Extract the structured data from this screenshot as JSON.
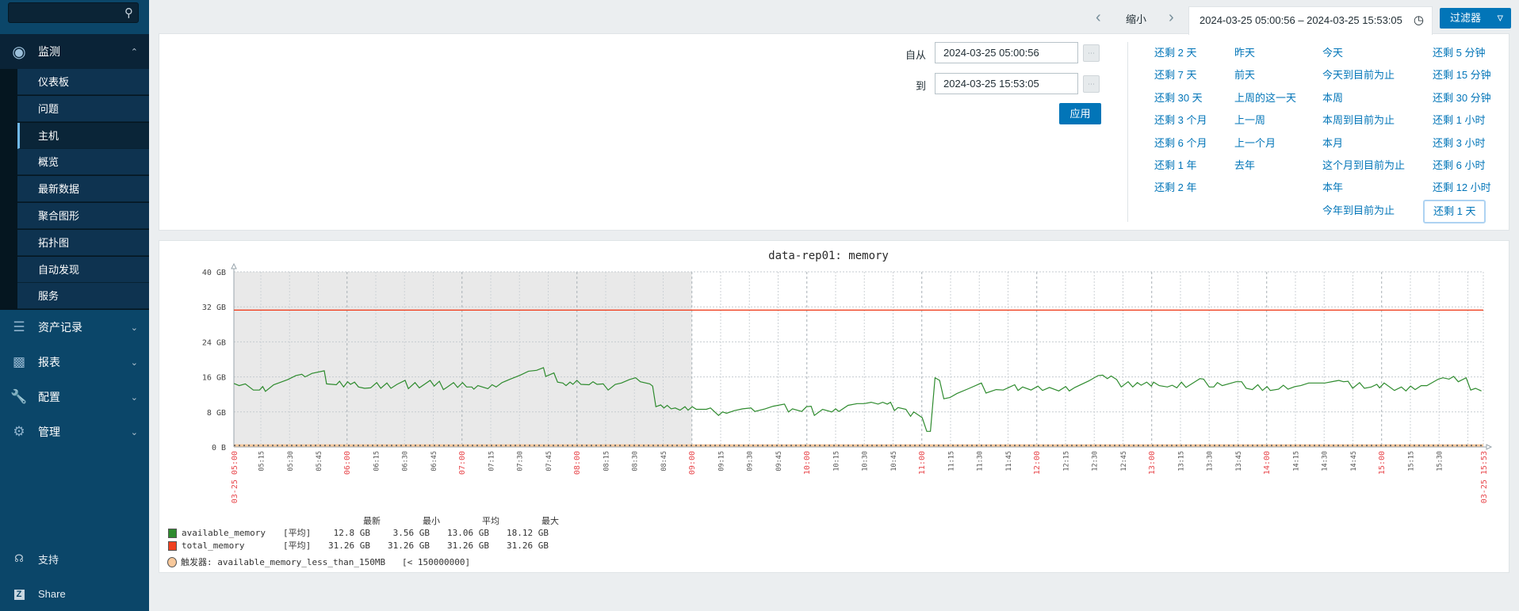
{
  "sidebar": {
    "search_placeholder": "",
    "monitor": {
      "label": "监测",
      "items": [
        "仪表板",
        "问题",
        "主机",
        "概览",
        "最新数据",
        "聚合图形",
        "拓扑图",
        "自动发现",
        "服务"
      ],
      "active": "主机"
    },
    "menus": [
      "资产记录",
      "报表",
      "配置",
      "管理"
    ],
    "footer": {
      "support": "支持",
      "share": "Share"
    }
  },
  "topbar": {
    "zoom_out": "缩小",
    "time_range": "2024-03-25 05:00:56 – 2024-03-25 15:53:05",
    "filter_button": "过滤器"
  },
  "filter": {
    "from_label": "自从",
    "from_value": "2024-03-25 05:00:56",
    "to_label": "到",
    "to_value": "2024-03-25 15:53:05",
    "apply": "应用",
    "quick": [
      [
        "还剩 2 天",
        "还剩 7 天",
        "还剩 30 天",
        "还剩 3 个月",
        "还剩 6 个月",
        "还剩 1 年",
        "还剩 2 年"
      ],
      [
        "昨天",
        "前天",
        "上周的这一天",
        "上一周",
        "上一个月",
        "去年"
      ],
      [
        "今天",
        "今天到目前为止",
        "本周",
        "本周到目前为止",
        "本月",
        "这个月到目前为止",
        "本年",
        "今年到目前为止"
      ],
      [
        "还剩 5 分钟",
        "还剩 15 分钟",
        "还剩 30 分钟",
        "还剩 1 小时",
        "还剩 3 小时",
        "还剩 6 小时",
        "还剩 12 小时",
        "还剩 1 天"
      ]
    ],
    "selected": "还剩 1 天"
  },
  "legend": {
    "headers": [
      "最新",
      "最小",
      "平均",
      "最大"
    ],
    "rows": [
      {
        "name": "available_memory",
        "func": "[平均]",
        "values": [
          "12.8 GB",
          "3.56 GB",
          "13.06 GB",
          "18.12 GB"
        ],
        "color": "#2e8b2e"
      },
      {
        "name": "total_memory",
        "func": "[平均]",
        "values": [
          "31.26 GB",
          "31.26 GB",
          "31.26 GB",
          "31.26 GB"
        ],
        "color": "#f0401f"
      }
    ],
    "trigger": {
      "label": "触发器: available_memory_less_than_150MB",
      "condition": "[< 150000000]",
      "color": "#f7c89b"
    }
  },
  "chart_data": {
    "type": "line",
    "title": "data-rep01: memory",
    "x_unit": "minutes since 03-25 05:00",
    "x_range": [
      0.93,
      653.08
    ],
    "x_start_label": "03-25 05:00",
    "x_end_label": "03-25 15:53",
    "shaded_until": 240,
    "ylim": [
      0,
      40
    ],
    "y_unit": "GB",
    "y_ticks": [
      {
        "v": 0,
        "label": "0 B"
      },
      {
        "v": 8,
        "label": "8 GB"
      },
      {
        "v": 16,
        "label": "16 GB"
      },
      {
        "v": 24,
        "label": "24 GB"
      },
      {
        "v": 32,
        "label": "32 GB"
      },
      {
        "v": 40,
        "label": "40 GB"
      }
    ],
    "x_ticks": [
      "05:15",
      "05:30",
      "05:45",
      "06:00",
      "06:15",
      "06:30",
      "06:45",
      "07:00",
      "07:15",
      "07:30",
      "07:45",
      "08:00",
      "08:15",
      "08:30",
      "08:45",
      "09:00",
      "09:15",
      "09:30",
      "09:45",
      "10:00",
      "10:15",
      "10:30",
      "10:45",
      "11:00",
      "11:15",
      "11:30",
      "11:45",
      "12:00",
      "12:15",
      "12:30",
      "12:45",
      "13:00",
      "13:15",
      "13:30",
      "13:45",
      "14:00",
      "14:15",
      "14:30",
      "14:45",
      "15:00",
      "15:15",
      "15:30"
    ],
    "grid": true,
    "series": [
      {
        "name": "available_memory",
        "color": "#2e8b2e",
        "points": [
          [
            1,
            14.5
          ],
          [
            3.7,
            14.0
          ],
          [
            6.9,
            14.4
          ],
          [
            11.1,
            13.0
          ],
          [
            14.3,
            13.0
          ],
          [
            16,
            13.8
          ],
          [
            17.4,
            12.7
          ],
          [
            21.7,
            14.2
          ],
          [
            24.8,
            14.7
          ],
          [
            29.1,
            15.4
          ],
          [
            33.3,
            16.3
          ],
          [
            36.4,
            16.6
          ],
          [
            38.1,
            16.0
          ],
          [
            41.7,
            16.8
          ],
          [
            48.1,
            17.4
          ],
          [
            49.3,
            14.4
          ],
          [
            54.4,
            14.2
          ],
          [
            56.1,
            15.0
          ],
          [
            58.2,
            13.7
          ],
          [
            60.3,
            14.9
          ],
          [
            61.8,
            14.3
          ],
          [
            63.9,
            14.8
          ],
          [
            66,
            13.7
          ],
          [
            69.2,
            13.4
          ],
          [
            72.3,
            13.5
          ],
          [
            75.5,
            14.7
          ],
          [
            77.6,
            13.4
          ],
          [
            80.8,
            14.6
          ],
          [
            82.9,
            13.4
          ],
          [
            86.1,
            14.3
          ],
          [
            90.3,
            15.2
          ],
          [
            92,
            13.3
          ],
          [
            95.5,
            14.7
          ],
          [
            97.7,
            13.5
          ],
          [
            103.4,
            15.2
          ],
          [
            105.5,
            13.9
          ],
          [
            108.2,
            15.0
          ],
          [
            110.3,
            13.1
          ],
          [
            112.4,
            13.7
          ],
          [
            115.6,
            14.7
          ],
          [
            117.7,
            13.6
          ],
          [
            120.3,
            14.7
          ],
          [
            122.4,
            13.7
          ],
          [
            125.1,
            13.7
          ],
          [
            126.2,
            13.2
          ],
          [
            128.3,
            14.0
          ],
          [
            133.5,
            13.3
          ],
          [
            135.7,
            14.2
          ],
          [
            137.8,
            13.7
          ],
          [
            140.9,
            14.7
          ],
          [
            145.2,
            15.5
          ],
          [
            150.4,
            16.4
          ],
          [
            154.7,
            17.3
          ],
          [
            158.9,
            17.5
          ],
          [
            162.5,
            18.12
          ],
          [
            163.7,
            16.1
          ],
          [
            168,
            16.9
          ],
          [
            169.9,
            14.8
          ],
          [
            172.6,
            14.6
          ],
          [
            174.3,
            14.0
          ],
          [
            176.4,
            14.8
          ],
          [
            177.9,
            14.3
          ],
          [
            180,
            15.2
          ],
          [
            182.1,
            14.3
          ],
          [
            186.3,
            14.2
          ],
          [
            188.4,
            14.9
          ],
          [
            190.5,
            14.3
          ],
          [
            193.7,
            14.4
          ],
          [
            196.3,
            13.0
          ],
          [
            200,
            14.3
          ],
          [
            203.2,
            14.6
          ],
          [
            207.4,
            15.4
          ],
          [
            210.6,
            15.8
          ],
          [
            213.1,
            14.9
          ],
          [
            218,
            14.4
          ],
          [
            219.5,
            13.9
          ],
          [
            221.2,
            9.2
          ],
          [
            223.7,
            9.6
          ],
          [
            225.4,
            8.9
          ],
          [
            227.1,
            9.5
          ],
          [
            229.2,
            8.7
          ],
          [
            231.3,
            8.9
          ],
          [
            233.8,
            8.4
          ],
          [
            236.4,
            9.2
          ],
          [
            238,
            8.4
          ],
          [
            240.2,
            9.2
          ],
          [
            242.3,
            8.6
          ],
          [
            247.5,
            8.6
          ],
          [
            249.7,
            8.9
          ],
          [
            253.9,
            7.2
          ],
          [
            256,
            8.0
          ],
          [
            258.1,
            7.7
          ],
          [
            262.3,
            8.3
          ],
          [
            266.5,
            8.7
          ],
          [
            270.8,
            8.9
          ],
          [
            272.9,
            8.1
          ],
          [
            278.2,
            8.7
          ],
          [
            282.4,
            9.3
          ],
          [
            288.3,
            9.8
          ],
          [
            290.4,
            8.0
          ],
          [
            292.5,
            8.7
          ],
          [
            297.3,
            8.1
          ],
          [
            299.8,
            9.2
          ],
          [
            302.2,
            9.3
          ],
          [
            303.9,
            7.2
          ],
          [
            308.2,
            8.6
          ],
          [
            313,
            8.0
          ],
          [
            315,
            8.7
          ],
          [
            316.7,
            8.1
          ],
          [
            321.5,
            9.5
          ],
          [
            326.3,
            9.9
          ],
          [
            330,
            9.9
          ],
          [
            333.6,
            10.2
          ],
          [
            337.2,
            9.8
          ],
          [
            339.6,
            10.2
          ],
          [
            342,
            9.8
          ],
          [
            343.7,
            10.2
          ],
          [
            345.7,
            8.3
          ],
          [
            347.6,
            9.0
          ],
          [
            351.7,
            8.6
          ],
          [
            354.1,
            7.0
          ],
          [
            355.8,
            8.0
          ],
          [
            360.2,
            6.7
          ],
          [
            362.6,
            3.56
          ],
          [
            364.5,
            3.56
          ],
          [
            366.9,
            15.8
          ],
          [
            369.3,
            15.2
          ],
          [
            371.5,
            11.0
          ],
          [
            374.7,
            11.3
          ],
          [
            378.3,
            12.2
          ],
          [
            384.3,
            13.3
          ],
          [
            391.1,
            14.6
          ],
          [
            393.5,
            12.3
          ],
          [
            398.8,
            13.1
          ],
          [
            402.5,
            13.0
          ],
          [
            408.5,
            14.2
          ],
          [
            410.2,
            12.9
          ],
          [
            412.6,
            13.7
          ],
          [
            417,
            13.0
          ],
          [
            420.6,
            13.9
          ],
          [
            423,
            12.9
          ],
          [
            426.6,
            13.6
          ],
          [
            431.5,
            12.8
          ],
          [
            435.1,
            13.8
          ],
          [
            437,
            12.8
          ],
          [
            439.9,
            13.6
          ],
          [
            447.2,
            15.1
          ],
          [
            452,
            16.3
          ],
          [
            454.4,
            16.4
          ],
          [
            456.8,
            15.6
          ],
          [
            458.8,
            16.2
          ],
          [
            461.7,
            15.4
          ],
          [
            464.1,
            13.7
          ],
          [
            467.7,
            14.9
          ],
          [
            470.1,
            13.7
          ],
          [
            472.5,
            14.7
          ],
          [
            474.5,
            14.1
          ],
          [
            477.4,
            14.8
          ],
          [
            479.8,
            13.9
          ],
          [
            481,
            14.8
          ],
          [
            483.9,
            14.0
          ],
          [
            488.2,
            13.7
          ],
          [
            490.7,
            14.1
          ],
          [
            493.1,
            13.5
          ],
          [
            495.5,
            14.8
          ],
          [
            497.9,
            13.6
          ],
          [
            505.2,
            15.6
          ],
          [
            507.1,
            15.5
          ],
          [
            510,
            13.7
          ],
          [
            512.4,
            13.7
          ],
          [
            514.3,
            14.7
          ],
          [
            516.8,
            14.0
          ],
          [
            524,
            14.9
          ],
          [
            526.9,
            14.9
          ],
          [
            529.3,
            13.4
          ],
          [
            532.5,
            13.1
          ],
          [
            535.4,
            14.2
          ],
          [
            537.8,
            12.9
          ],
          [
            540.2,
            13.8
          ],
          [
            541.9,
            12.9
          ],
          [
            546.2,
            13.2
          ],
          [
            548.7,
            14.1
          ],
          [
            551.1,
            13.2
          ],
          [
            554.7,
            13.8
          ],
          [
            557.8,
            14.0
          ],
          [
            561.9,
            14.6
          ],
          [
            570.4,
            14.6
          ],
          [
            575.2,
            15.0
          ],
          [
            577.7,
            15.2
          ],
          [
            580.1,
            14.9
          ],
          [
            582.5,
            15.0
          ],
          [
            584.9,
            13.4
          ],
          [
            588.5,
            14.7
          ],
          [
            591,
            13.4
          ],
          [
            594.6,
            13.7
          ],
          [
            597.5,
            14.3
          ],
          [
            598.9,
            13.5
          ],
          [
            601.3,
            14.6
          ],
          [
            606.7,
            12.9
          ],
          [
            610.3,
            13.7
          ],
          [
            612.7,
            12.8
          ],
          [
            615.1,
            13.9
          ],
          [
            617.5,
            13.1
          ],
          [
            620.7,
            14.0
          ],
          [
            623.6,
            14.0
          ],
          [
            629.6,
            15.5
          ],
          [
            632,
            15.8
          ],
          [
            635.2,
            15.5
          ],
          [
            637.6,
            16.1
          ],
          [
            640,
            14.9
          ],
          [
            644.1,
            15.8
          ],
          [
            646.5,
            13.0
          ],
          [
            649,
            13.4
          ],
          [
            652.1,
            12.8
          ]
        ]
      },
      {
        "name": "total_memory",
        "color": "#f0401f",
        "constant": 31.26
      }
    ],
    "trigger_threshold_gb": 0.15
  }
}
